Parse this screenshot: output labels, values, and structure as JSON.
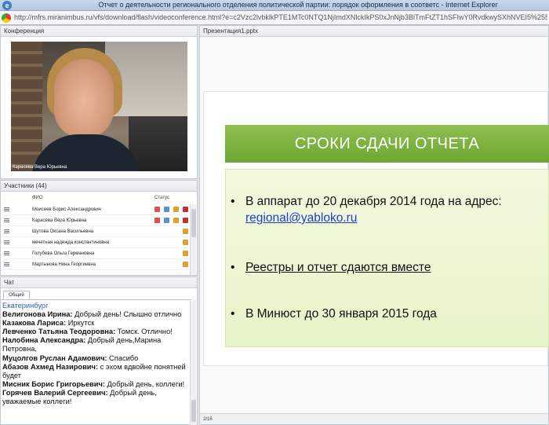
{
  "window": {
    "title": "Отчет о деятельности регионального отделения политической партии: порядок оформления в соответс - Internet Explorer",
    "url": "http://mfrs.miranimbus.ru/vfs/download/flash/videoconference.html?e=c2Vzc2lvbklkPTE1MTc0NTQ1NjImdXNlckIkPS0xJnNjb3BlTmFtZT1hSFIwY0RvdkwySXhNVEI5%255B%255BT1M1Mz"
  },
  "conference": {
    "header": "Конференция",
    "video_caption": "Карасева Вера Юрьевна"
  },
  "participants": {
    "header": "Участники (44)",
    "col_name": "ФИО",
    "col_status": "Статус",
    "rows": [
      {
        "name": "Моисеев Борис Александрович"
      },
      {
        "name": "Карасева Вера Юрьевна"
      },
      {
        "name": "Шутова Оксана Васильевна"
      },
      {
        "name": "мечетная надежда  константиновна"
      },
      {
        "name": "Голубева Ольга  Германовна"
      },
      {
        "name": "Мартынова Нина  Георгиевна"
      }
    ]
  },
  "chat": {
    "header": "Чат",
    "tab": "Общий",
    "messages": [
      {
        "author": "",
        "text": "Екатеринбург",
        "city": true
      },
      {
        "author": "Велигонова Ирина:",
        "text": " Добрый день! Слышно отлично"
      },
      {
        "author": "Казакова  Лариса:",
        "text": " Иркутск"
      },
      {
        "author": "Левченко Татьяна Теодоровна:",
        "text": " Томск. Отлично!"
      },
      {
        "author": "Налобина Александра:",
        "text": " Добрый день,Марина Петровна,"
      },
      {
        "author": "Муцолгов Руслан  Адамович:",
        "text": " Спасибо"
      },
      {
        "author": "Абазов Ахмед Назирович:",
        "text": " с эхом вдвойне понятней будет"
      },
      {
        "author": "Мисник Борис Григорьевич:",
        "text": " Добрый день, коллеги!"
      },
      {
        "author": "Горячев Валерий Сергеевич:",
        "text": " Добрый день, уважаемые коллеги!"
      }
    ]
  },
  "presentation": {
    "header": "Презентация1.pptx",
    "slide_title": "СРОКИ СДАЧИ ОТЧЕТА",
    "bullet1_text": "В аппарат до 20 декабря 2014 года на адрес: ",
    "bullet1_link": "regional@yabloko.ru",
    "bullet2_text": "Реестры и отчет сдаются вместе",
    "bullet3_text": "В Минюст до 30 января 2015 года",
    "bullet_char": "•",
    "page": "2/16"
  },
  "colors": {
    "slide_title_bg": "#7db243",
    "slide_body_bg": "#ecf6d3",
    "link": "#1f3bd6"
  }
}
